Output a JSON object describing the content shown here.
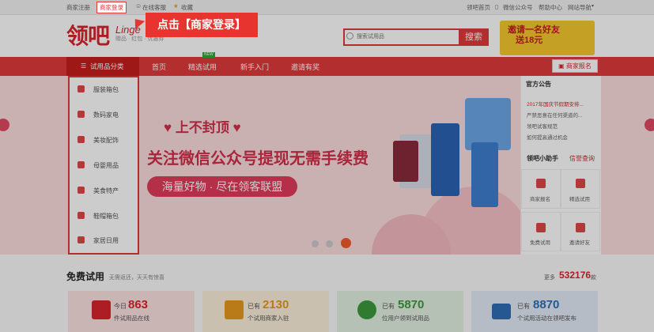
{
  "topbar": {
    "register": "商家注册",
    "login": "商家登录",
    "online_service": "在线客服",
    "favorite": "收藏",
    "welcome": "领吧首页",
    "wechat": "微信公众号",
    "help": "帮助中心",
    "site_nav": "网站导航"
  },
  "header": {
    "logo_cn": "领吧",
    "logo_en": "Linge",
    "slogan": "赠品 · 红包 · 优惠券",
    "search_placeholder": "搜索试用品",
    "search_button": "搜索",
    "promo_line1": "邀请一名好友",
    "promo_line2": "送18元"
  },
  "nav": {
    "categories": "试用品分类",
    "items": [
      "首页",
      "精选试用",
      "新手入门",
      "邀请有奖"
    ],
    "hot_badge": "NEW",
    "merchant_report": "商家报名"
  },
  "side_menu": [
    "服装箱包",
    "数码家电",
    "美妆配饰",
    "母婴用品",
    "美食特产",
    "鞋帽箱包",
    "家居日用"
  ],
  "hero": {
    "line1": "上不封顶",
    "line2": "关注微信公众号提现无需手续费",
    "pill": "海量好物 · 尽在领客联盟"
  },
  "notices": {
    "title": "官方公告",
    "items": [
      "2017年国庆节假期安排...",
      "严禁恶意在任何渠道的...",
      "领吧试客规范",
      "如何提高通过机会"
    ]
  },
  "helper": {
    "tab1": "领吧小助手",
    "tab2": "信誉查询",
    "items": [
      "商家报名",
      "精选试用",
      "免费试用",
      "邀请好友"
    ]
  },
  "free_trial": {
    "title": "免费试用",
    "subtitle": "无需返还，天天有惊喜",
    "count_label": "更多",
    "count_value": "532176",
    "count_unit": "款"
  },
  "stats": [
    {
      "prefix": "今日",
      "number": "863",
      "desc": "件试用品在线"
    },
    {
      "prefix": "已有",
      "number": "2130",
      "desc": "个试用商家入驻"
    },
    {
      "prefix": "已有",
      "number": "5870",
      "desc": "位用户领到试用品"
    },
    {
      "prefix": "已有",
      "number": "8870",
      "desc": "个试用活动在领吧发布"
    }
  ],
  "stat_colors": [
    "#d8262e",
    "#e69a1e",
    "#3c9a3c",
    "#2f6fb5"
  ],
  "callout": "点击【商家登录】"
}
